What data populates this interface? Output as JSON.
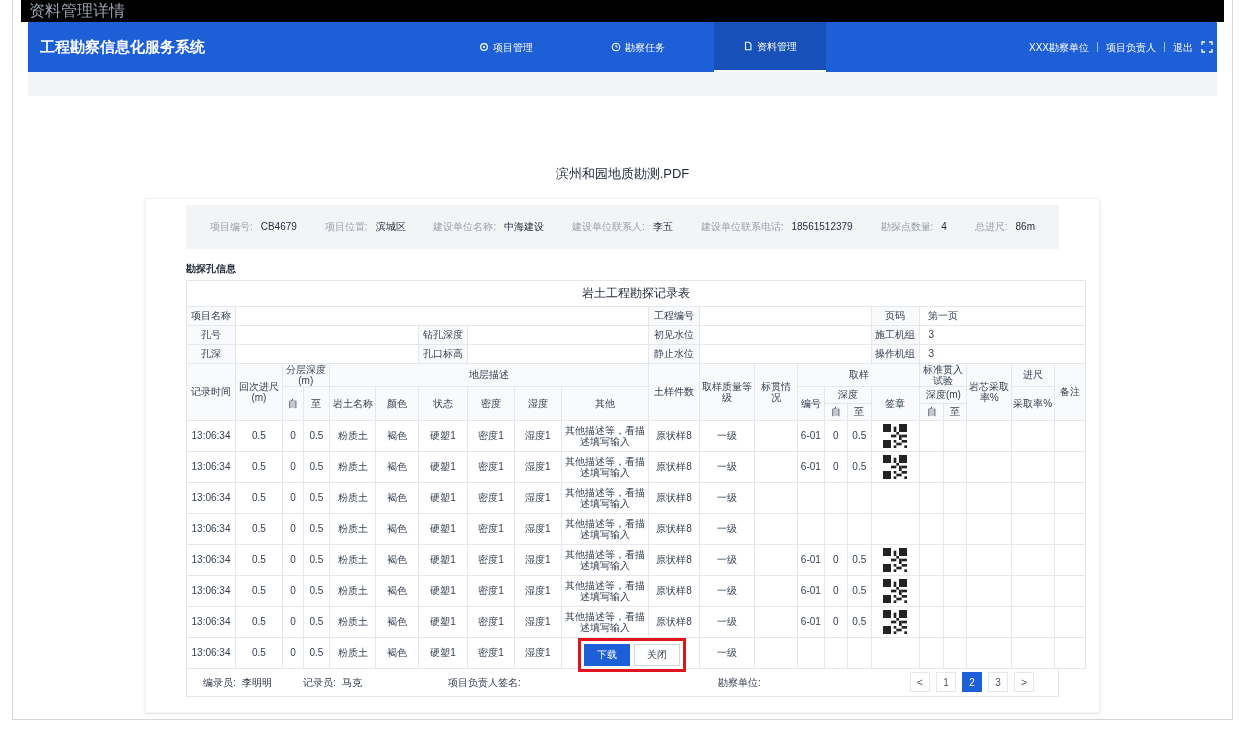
{
  "window": {
    "title": "资料管理详情"
  },
  "app": {
    "title": "工程勘察信息化服务系统"
  },
  "nav": [
    {
      "label": "项目管理",
      "selected": false
    },
    {
      "label": "勘察任务",
      "selected": false
    },
    {
      "label": "资料管理",
      "selected": true
    }
  ],
  "user_menu": [
    "XXX勘察单位",
    "项目负责人",
    "退出"
  ],
  "document": {
    "title": "滨州和园地质勘测.PDF",
    "info": [
      {
        "label": "项目编号:",
        "value": "CB4679"
      },
      {
        "label": "项目位置:",
        "value": "滨城区"
      },
      {
        "label": "建设单位名称:",
        "value": "中海建设"
      },
      {
        "label": "建设单位联系人:",
        "value": "李五"
      },
      {
        "label": "建设单位联系电话:",
        "value": "18561512379"
      },
      {
        "label": "勘探点数量:",
        "value": "4"
      },
      {
        "label": "总进尺:",
        "value": "86m"
      }
    ],
    "section_title": "勘探孔信息",
    "record_table": {
      "title": "岩土工程勘探记录表",
      "fields": [
        [
          {
            "label": "项目名称"
          },
          {
            "label": "工程编号"
          },
          {
            "label": "页码",
            "value": "第一页"
          }
        ],
        [
          {
            "label": "孔号"
          },
          {
            "label": "钻孔深度"
          },
          {
            "label": "初见水位"
          },
          {
            "label": "施工机组",
            "value": "3"
          }
        ],
        [
          {
            "label": "孔深"
          },
          {
            "label": "孔口标高"
          },
          {
            "label": "静止水位"
          },
          {
            "label": "操作机组",
            "value": "3"
          }
        ]
      ],
      "columns": [
        {
          "label": "记录时间"
        },
        {
          "label": "回次进尺(m)"
        },
        {
          "label": "分层深度(m)",
          "children": [
            {
              "label": "自"
            },
            {
              "label": "至"
            }
          ]
        },
        {
          "label": "地层描述",
          "children": [
            {
              "label": "岩土名称"
            },
            {
              "label": "颜色"
            },
            {
              "label": "状态"
            },
            {
              "label": "密度"
            },
            {
              "label": "湿度"
            },
            {
              "label": "其他"
            }
          ]
        },
        {
          "label": "土样件数"
        },
        {
          "label": "取样质量等级"
        },
        {
          "label": "标贯情况"
        },
        {
          "label": "取样",
          "children": [
            {
              "label": "编号"
            },
            {
              "label": "深度",
              "children": [
                {
                  "label": "自"
                },
                {
                  "label": "至"
                }
              ]
            },
            {
              "label": "签章"
            }
          ]
        },
        {
          "label": "标准贯入试验",
          "children": [
            {
              "label": "深度(m)",
              "children": [
                {
                  "label": "自"
                },
                {
                  "label": "至"
                }
              ]
            }
          ]
        },
        {
          "label": "岩芯采取率%"
        },
        {
          "label": "进尺",
          "children": [
            {
              "label": "采取率%"
            }
          ]
        },
        {
          "label": "备注"
        }
      ],
      "rows": [
        {
          "time": "13:06:34",
          "advance": "0.5",
          "from": "0",
          "to": "0.5",
          "soil": "粉质土",
          "soil_color": "褐色",
          "state": "硬塑1",
          "density": "密度1",
          "humidity": "湿度1",
          "other": "其他描述等，看描述填写输入",
          "samples": "原状样8",
          "grade": "一级",
          "sample_no": "6-01",
          "sample_from": "0",
          "sample_to": "0.5",
          "qr_code": true
        },
        {
          "time": "13:06:34",
          "advance": "0.5",
          "from": "0",
          "to": "0.5",
          "soil": "粉质土",
          "soil_color": "褐色",
          "state": "硬塑1",
          "density": "密度1",
          "humidity": "湿度1",
          "other": "其他描述等，看描述填写输入",
          "samples": "原状样8",
          "grade": "一级",
          "sample_no": "6-01",
          "sample_from": "0",
          "sample_to": "0.5",
          "qr_code": true
        },
        {
          "time": "13:06:34",
          "advance": "0.5",
          "from": "0",
          "to": "0.5",
          "soil": "粉质土",
          "soil_color": "褐色",
          "state": "硬塑1",
          "density": "密度1",
          "humidity": "湿度1",
          "other": "其他描述等，看描述填写输入",
          "samples": "原状样8",
          "grade": "一级",
          "qr_code": false
        },
        {
          "time": "13:06:34",
          "advance": "0.5",
          "from": "0",
          "to": "0.5",
          "soil": "粉质土",
          "soil_color": "褐色",
          "state": "硬塑1",
          "density": "密度1",
          "humidity": "湿度1",
          "other": "其他描述等，看描述填写输入",
          "samples": "原状样8",
          "grade": "一级",
          "qr_code": false
        },
        {
          "time": "13:06:34",
          "advance": "0.5",
          "from": "0",
          "to": "0.5",
          "soil": "粉质土",
          "soil_color": "褐色",
          "state": "硬塑1",
          "density": "密度1",
          "humidity": "湿度1",
          "other": "其他描述等，看描述填写输入",
          "samples": "原状样8",
          "grade": "一级",
          "sample_no": "6-01",
          "sample_from": "0",
          "sample_to": "0.5",
          "qr_code": true
        },
        {
          "time": "13:06:34",
          "advance": "0.5",
          "from": "0",
          "to": "0.5",
          "soil": "粉质土",
          "soil_color": "褐色",
          "state": "硬塑1",
          "density": "密度1",
          "humidity": "湿度1",
          "other": "其他描述等，看描述填写输入",
          "samples": "原状样8",
          "grade": "一级",
          "sample_no": "6-01",
          "sample_from": "0",
          "sample_to": "0.5",
          "qr_code": true
        },
        {
          "time": "13:06:34",
          "advance": "0.5",
          "from": "0",
          "to": "0.5",
          "soil": "粉质土",
          "soil_color": "褐色",
          "state": "硬塑1",
          "density": "密度1",
          "humidity": "湿度1",
          "other": "其他描述等，看描述填写输入",
          "samples": "原状样8",
          "grade": "一级",
          "sample_no": "6-01",
          "sample_from": "0",
          "sample_to": "0.5",
          "qr_code": true
        },
        {
          "time": "13:06:34",
          "advance": "0.5",
          "from": "0",
          "to": "0.5",
          "soil": "粉质土",
          "soil_color": "褐色",
          "state": "硬塑1",
          "density": "密度1",
          "humidity": "湿度1",
          "grade": "一级",
          "qr_code": false
        }
      ],
      "footer": [
        {
          "label": "编录员:",
          "value": "李明明"
        },
        {
          "label": "记录员:",
          "value": "马克"
        },
        {
          "label": "项目负责人签名:"
        },
        {
          "label": "勘察单位:"
        }
      ]
    }
  },
  "actions": [
    {
      "label": "下载",
      "kind": "primary"
    },
    {
      "label": "关闭",
      "kind": "secondary"
    }
  ],
  "pagination": {
    "prev": "<",
    "pages": [
      {
        "label": "1",
        "selected": false
      },
      {
        "label": "2",
        "selected": true
      },
      {
        "label": "3",
        "selected": false
      }
    ],
    "next": ">"
  }
}
